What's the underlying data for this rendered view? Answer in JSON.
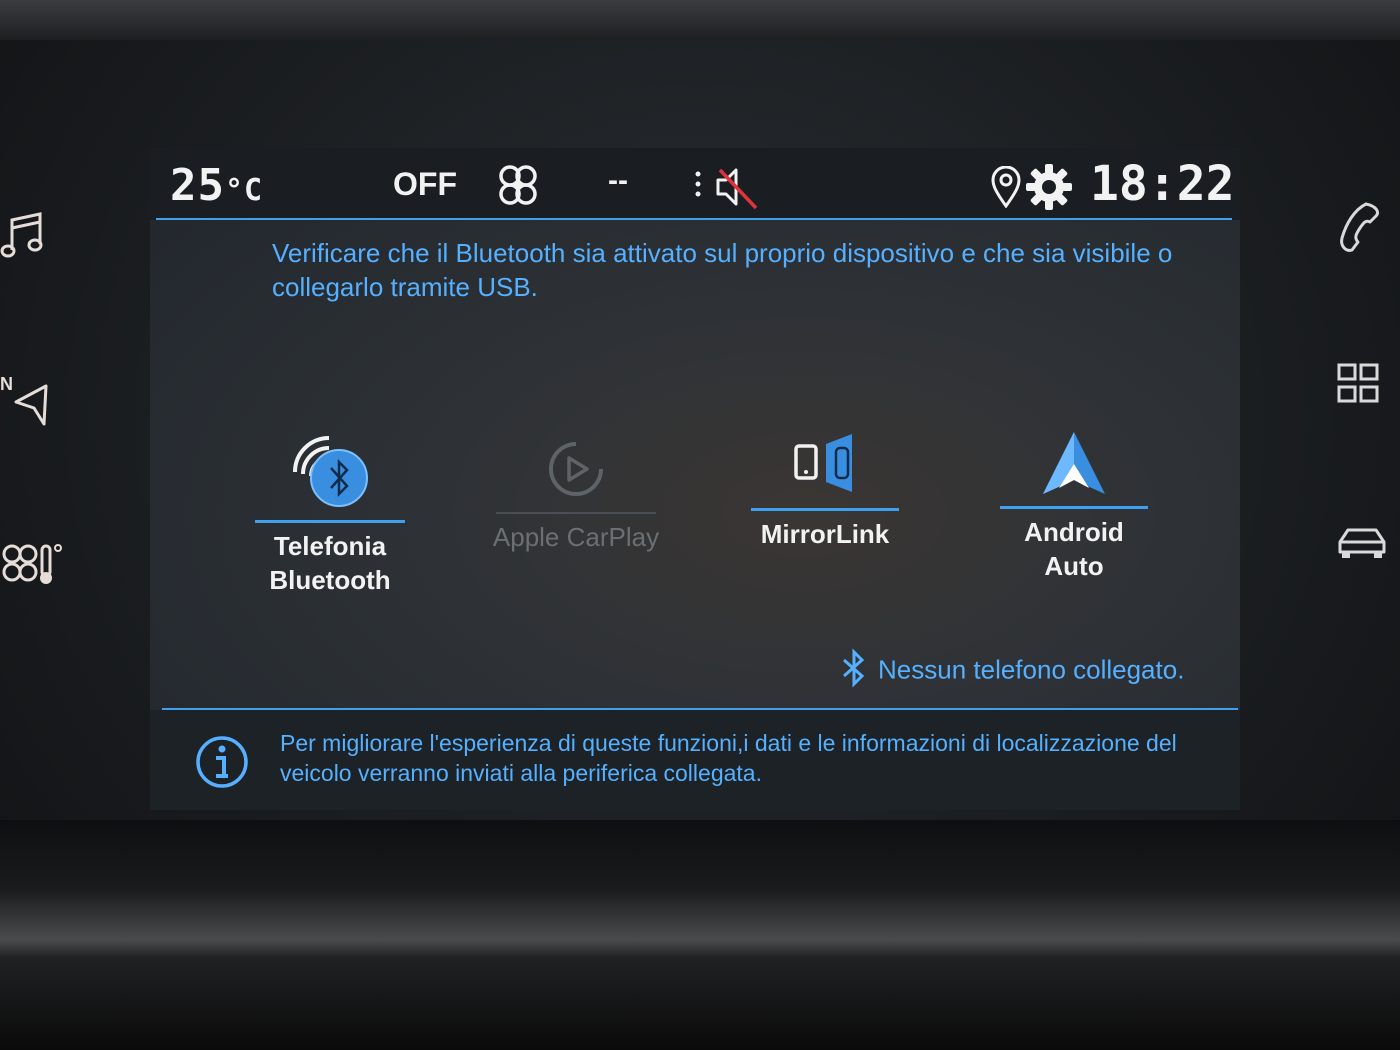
{
  "status_bar": {
    "temperature": "25",
    "temperature_unit": "°C",
    "ac_status": "OFF",
    "fan_level": "--",
    "clock": "18:22"
  },
  "instructions": "Verificare che il Bluetooth sia attivato sul proprio dispositivo e che sia visibile o collegarlo tramite USB.",
  "connections": [
    {
      "label_line1": "Telefonia",
      "label_line2": "Bluetooth",
      "icon": "bluetooth-phone-icon",
      "enabled": true
    },
    {
      "label_line1": "Apple CarPlay",
      "label_line2": "",
      "icon": "carplay-icon",
      "enabled": false
    },
    {
      "label_line1": "MirrorLink",
      "label_line2": "",
      "icon": "mirrorlink-icon",
      "enabled": true
    },
    {
      "label_line1": "Android Auto",
      "label_line2": "",
      "icon": "android-auto-icon",
      "enabled": true
    }
  ],
  "connection_status": "Nessun telefono collegato.",
  "info_message": "Per migliorare l'esperienza di queste funzioni,i dati e le informazioni di localizzazione del veicolo verranno inviati alla periferica collegata.",
  "left_buttons": [
    "music-icon",
    "navigation-icon",
    "climate-icon"
  ],
  "right_buttons": [
    "phone-icon",
    "apps-grid-icon",
    "car-icon"
  ],
  "colors": {
    "accent": "#3fa0f0",
    "text_accent": "#55b0ff",
    "background": "#2b3035"
  }
}
